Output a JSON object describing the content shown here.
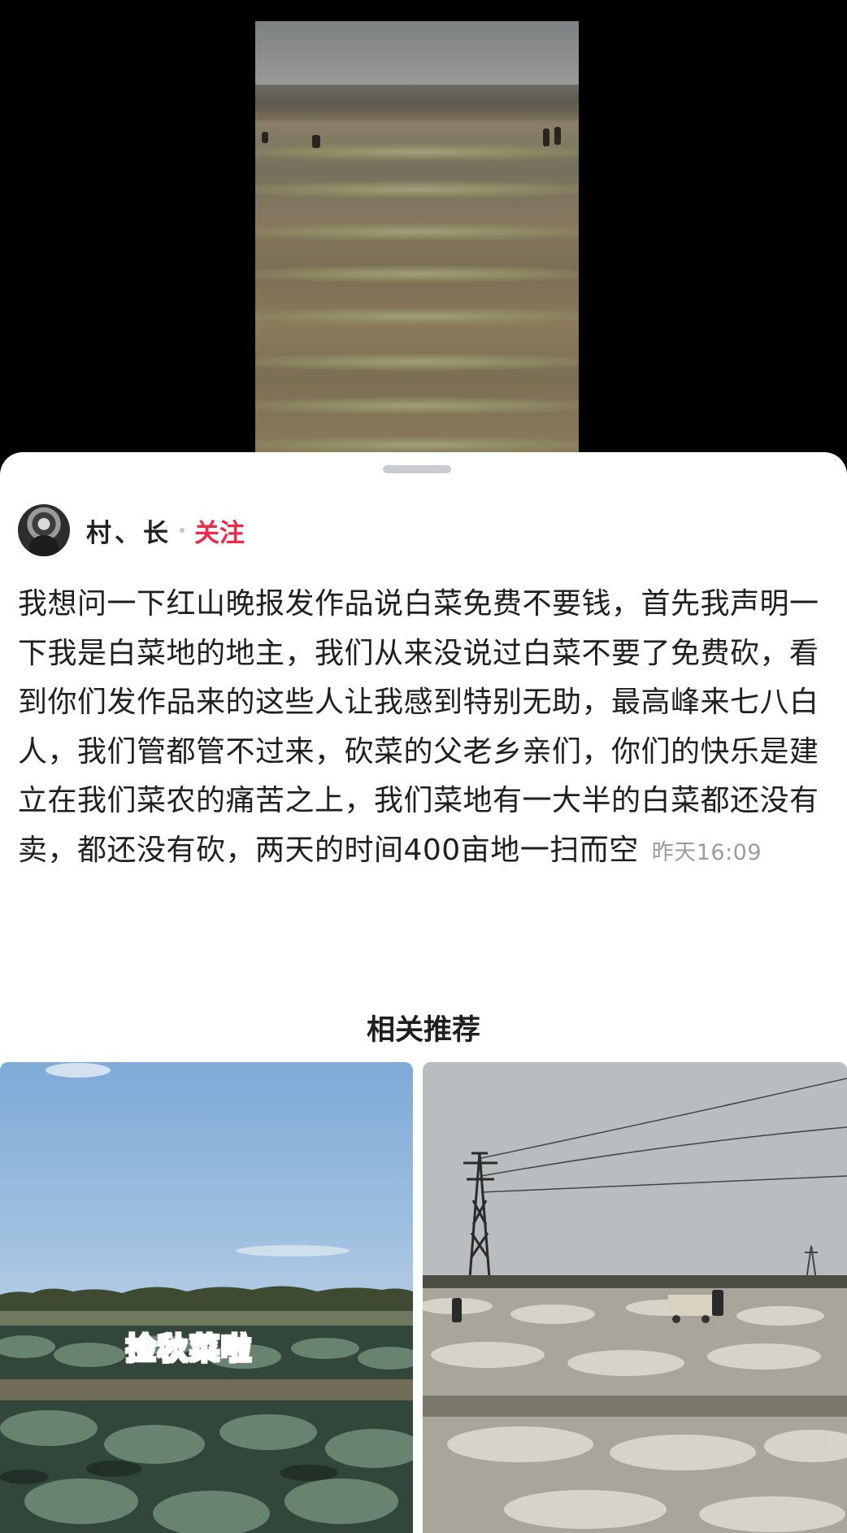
{
  "post": {
    "author_name": "村、长",
    "follow_label": "关注",
    "content": "我想问一下红山晚报发作品说白菜免费不要钱，首先我声明一下我是白菜地的地主，我们从来没说过白菜不要了免费砍，看到你们发作品来的这些人让我感到特别无助，最高峰来七八白人，我们管都管不过来，砍菜的父老乡亲们，你们的快乐是建立在我们菜农的痛苦之上，我们菜地有一大半的白菜都还没有卖，都还没有砍，两天的时间400亩地一扫而空",
    "time": "昨天16:09"
  },
  "related": {
    "title": "相关推荐",
    "cards": [
      {
        "overlay_text": "捡秋菜啦"
      },
      {
        "overlay_text": ""
      }
    ]
  },
  "colors": {
    "accent": "#ee2a4a",
    "overlay_text": "#ff4b6a",
    "text": "#1f1f1f",
    "muted": "#9c9c9c"
  }
}
